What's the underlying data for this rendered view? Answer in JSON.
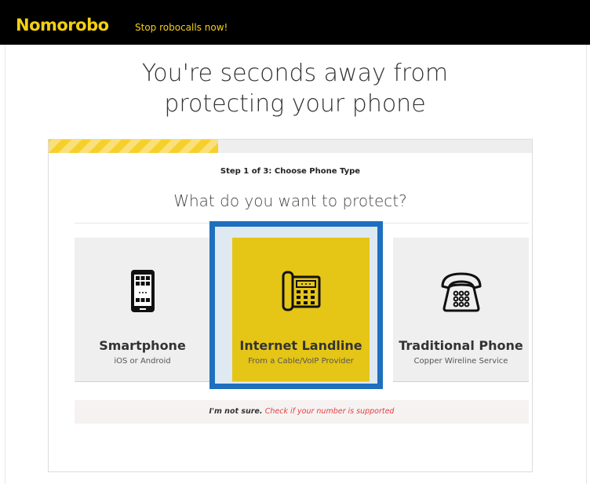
{
  "header": {
    "brand": "Nomorobo",
    "tagline": "Stop robocalls now!",
    "brand_color": "#f4d010"
  },
  "headline": {
    "line1": "You're seconds away from",
    "line2": "protecting your phone"
  },
  "wizard": {
    "progress": 0.35,
    "step_label": "Step 1 of 3: Choose Phone Type",
    "question": "What do you want to protect?",
    "options": [
      {
        "title": "Smartphone",
        "subtitle": "iOS or Android",
        "icon": "smartphone-icon",
        "selected": false
      },
      {
        "title": "Internet Landline",
        "subtitle": "From a Cable/VoIP Provider",
        "icon": "desk-phone-icon",
        "selected": true
      },
      {
        "title": "Traditional Phone",
        "subtitle": "Copper Wireline Service",
        "icon": "rotary-phone-icon",
        "selected": false
      }
    ],
    "not_sure": {
      "label": "I'm not sure.",
      "link": "Check if your number is supported"
    },
    "selected_color": "#e5c516",
    "highlight_color": "#1f6fbf"
  }
}
